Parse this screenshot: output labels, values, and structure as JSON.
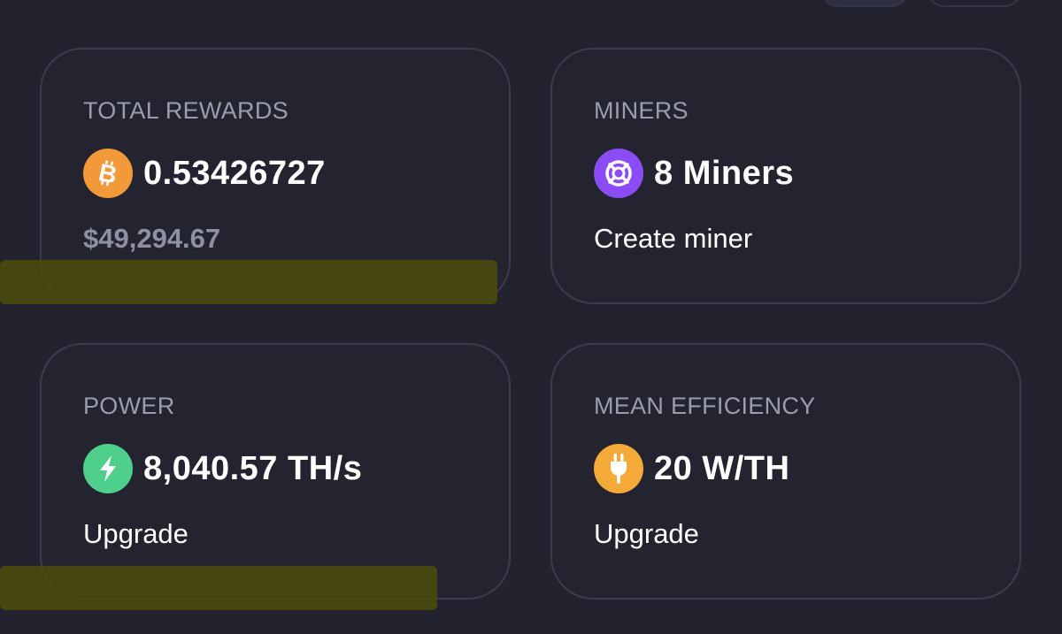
{
  "colors": {
    "background": "#22232f",
    "card_border": "#3a3c50",
    "label": "#9a9cb0",
    "bitcoin": "#f2993a",
    "miners": "#8b4cf6",
    "power": "#4fcf8c",
    "efficiency": "#f4aa38",
    "highlight": "#4a4a0e"
  },
  "cards": [
    {
      "label": "TOTAL REWARDS",
      "icon": "bitcoin-icon",
      "value": "0.53426727",
      "sub": "$49,294.67"
    },
    {
      "label": "MINERS",
      "icon": "miners-icon",
      "value": "8 Miners",
      "sub": "Create miner"
    },
    {
      "label": "POWER",
      "icon": "lightning-icon",
      "value": "8,040.57 TH/s",
      "sub": "Upgrade"
    },
    {
      "label": "MEAN EFFICIENCY",
      "icon": "plug-icon",
      "value": "20 W/TH",
      "sub": "Upgrade"
    }
  ]
}
